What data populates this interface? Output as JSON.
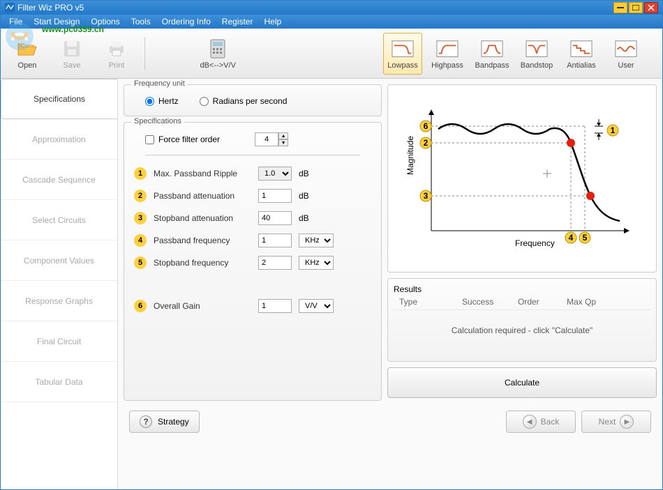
{
  "title": "Filter Wiz PRO v5",
  "watermark_url": "www.pc0359.cn",
  "menu": [
    "File",
    "Start Design",
    "Options",
    "Tools",
    "Ordering Info",
    "Register",
    "Help"
  ],
  "toolbar": {
    "open": "Open",
    "save": "Save",
    "print": "Print",
    "db_vv": "dB<-->V/V",
    "lowpass": "Lowpass",
    "highpass": "Highpass",
    "bandpass": "Bandpass",
    "bandstop": "Bandstop",
    "antialias": "Antialias",
    "user": "User"
  },
  "sidebar": {
    "items": [
      "Specifications",
      "Approximation",
      "Cascade Sequence",
      "Select Circuits",
      "Component Values",
      "Response Graphs",
      "Final Circuit",
      "Tabular Data"
    ]
  },
  "freq_unit": {
    "legend": "Frequency unit",
    "hertz": "Hertz",
    "radians": "Radians per second"
  },
  "specs": {
    "legend": "Specifications",
    "force_label": "Force filter order",
    "force_value": "4",
    "rows": [
      {
        "num": "1",
        "label": "Max. Passband Ripple",
        "value": "1.0",
        "unit": "dB",
        "unit_type": "select"
      },
      {
        "num": "2",
        "label": "Passband attenuation",
        "value": "1",
        "unit": "dB",
        "unit_type": "static"
      },
      {
        "num": "3",
        "label": "Stopband attenuation",
        "value": "40",
        "unit": "dB",
        "unit_type": "static"
      },
      {
        "num": "4",
        "label": "Passband frequency",
        "value": "1",
        "unit": "KHz",
        "unit_type": "select"
      },
      {
        "num": "5",
        "label": "Stopband frequency",
        "value": "2",
        "unit": "KHz",
        "unit_type": "select"
      }
    ],
    "gain": {
      "num": "6",
      "label": "Overall Gain",
      "value": "1",
      "unit": "V/V"
    }
  },
  "graph": {
    "ylabel": "Magnitude",
    "xlabel": "Frequency"
  },
  "results": {
    "legend": "Results",
    "cols": [
      "Type",
      "Success",
      "Order",
      "Max Qp"
    ],
    "message": "Calculation required - click \"Calculate\""
  },
  "calculate": "Calculate",
  "bottom": {
    "strategy": "Strategy",
    "back": "Back",
    "next": "Next"
  },
  "chart_data": {
    "type": "line",
    "title": "Lowpass filter response diagram",
    "xlabel": "Frequency",
    "ylabel": "Magnitude",
    "annotations": [
      "1",
      "2",
      "3",
      "4",
      "5",
      "6"
    ],
    "description": "Schematic lowpass magnitude response with passband ripple region (6), passband edge attenuation marker (2), stopband attenuation marker (3), passband frequency (4), stopband frequency (5), and ripple amplitude indicator (1)."
  }
}
